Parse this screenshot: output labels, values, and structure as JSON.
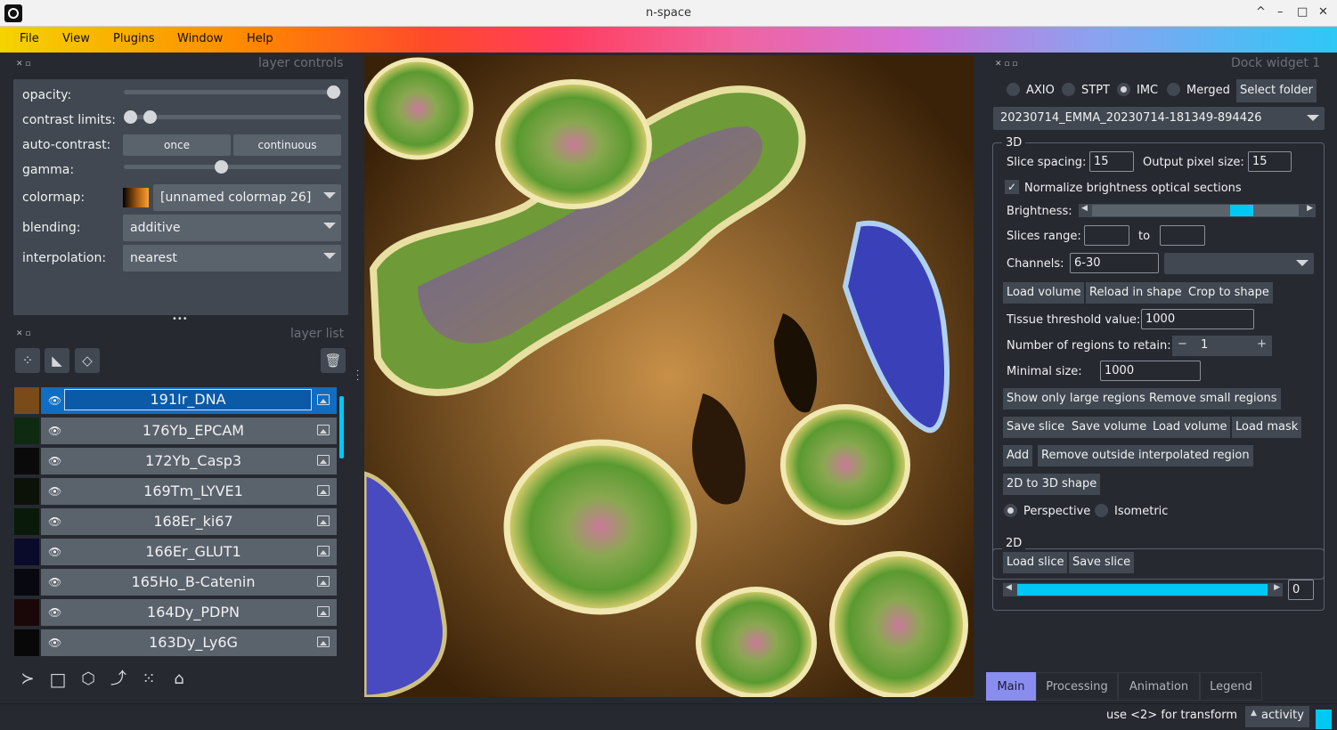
{
  "window": {
    "title": "n-space",
    "controls": [
      "^",
      "–",
      "□",
      "✕"
    ]
  },
  "menu": [
    "File",
    "View",
    "Plugins",
    "Window",
    "Help"
  ],
  "layer_controls": {
    "header": "layer controls",
    "opacity_label": "opacity:",
    "opacity_value": 1.0,
    "contrast_label": "contrast limits:",
    "auto_contrast_label": "auto-contrast:",
    "auto_once": "once",
    "auto_continuous": "continuous",
    "gamma_label": "gamma:",
    "colormap_label": "colormap:",
    "colormap_value": "[unnamed colormap 26]",
    "blending_label": "blending:",
    "blending_value": "additive",
    "interpolation_label": "interpolation:",
    "interpolation_value": "nearest",
    "more": "•••"
  },
  "layer_list": {
    "header": "layer list",
    "layers": [
      {
        "name": "191Ir_DNA",
        "selected": true,
        "thumb": "#7a4a18"
      },
      {
        "name": "176Yb_EPCAM",
        "selected": false,
        "thumb": "#0e2a10"
      },
      {
        "name": "172Yb_Casp3",
        "selected": false,
        "thumb": "#0a0a0a"
      },
      {
        "name": "169Tm_LYVE1",
        "selected": false,
        "thumb": "#0c1208"
      },
      {
        "name": "168Er_ki67",
        "selected": false,
        "thumb": "#0a1a0a"
      },
      {
        "name": "166Er_GLUT1",
        "selected": false,
        "thumb": "#0a0a2a"
      },
      {
        "name": "165Ho_B-Catenin",
        "selected": false,
        "thumb": "#080810"
      },
      {
        "name": "164Dy_PDPN",
        "selected": false,
        "thumb": "#1a0808"
      },
      {
        "name": "163Dy_Ly6G",
        "selected": false,
        "thumb": "#080808"
      }
    ]
  },
  "viewer_buttons": [
    "console-icon",
    "ndisplay-icon",
    "roll-icon",
    "transpose-icon",
    "grid-icon",
    "home-icon"
  ],
  "dock_widget": {
    "header": "Dock widget 1",
    "modes": [
      {
        "label": "AXIO",
        "selected": false
      },
      {
        "label": "STPT",
        "selected": false
      },
      {
        "label": "IMC",
        "selected": true
      },
      {
        "label": "Merged",
        "selected": false
      }
    ],
    "select_folder": "Select folder",
    "dataset": "20230714_EMMA_20230714-181349-894426",
    "g3d": {
      "title": "3D",
      "slice_spacing_label": "Slice spacing:",
      "slice_spacing": "15",
      "output_pixel_label": "Output pixel size:",
      "output_pixel": "15",
      "normalize_label": "Normalize brightness optical sections",
      "brightness_label": "Brightness:",
      "brightness_value": 0.75,
      "slices_range_label": "Slices range:",
      "slices_from": "",
      "to_label": "to",
      "slices_to": "",
      "channels_label": "Channels:",
      "channels_value": "6-30",
      "load_volume": "Load volume",
      "reload_in_shape": "Reload in shape",
      "crop_to_shape": "Crop to shape",
      "tissue_threshold_label": "Tissue threshold value:",
      "tissue_threshold": "1000",
      "regions_label": "Number of regions to retain:",
      "regions_minus": "−",
      "regions_value": "1",
      "regions_plus": "+",
      "minimal_size_label": "Minimal size:",
      "minimal_size": "1000",
      "show_large": "Show only large regions",
      "remove_small": "Remove small regions",
      "save_slice": "Save slice",
      "save_volume": "Save volume",
      "load_volume2": "Load volume",
      "load_mask": "Load mask",
      "add": "Add",
      "remove_outside": "Remove outside interpolated region",
      "to3d": "2D to 3D shape",
      "perspective": "Perspective",
      "isometric": "Isometric"
    },
    "g2d": {
      "title": "2D",
      "load_slice": "Load slice",
      "save_slice": "Save slice",
      "slider_value": "0",
      "slider_fraction": 0.0
    },
    "tabs": [
      "Main",
      "Processing",
      "Animation",
      "Legend"
    ]
  },
  "status": {
    "hint": "use <2> for transform",
    "activity": "activity"
  },
  "colors": {
    "accent": "#00c8f5",
    "selected": "#0f6ec3",
    "tab_active": "#8a8df0"
  }
}
